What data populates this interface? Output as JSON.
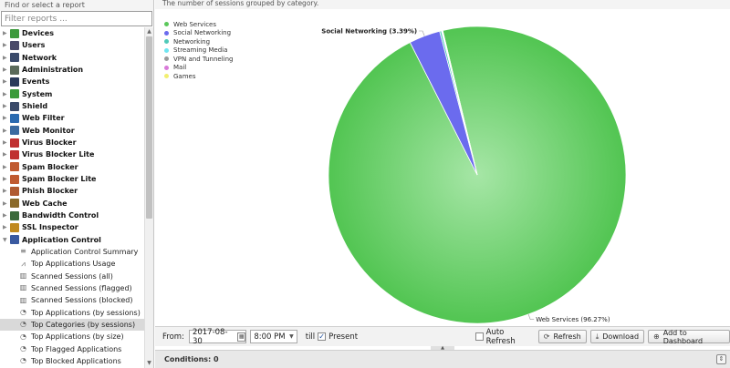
{
  "sidebar": {
    "title": "Find or select a report",
    "filter_placeholder": "Filter reports ...",
    "categories": [
      {
        "label": "Devices",
        "icon": "devices-icon",
        "color": "#3d9a3d"
      },
      {
        "label": "Users",
        "icon": "users-icon",
        "color": "#4a4a6a"
      },
      {
        "label": "Network",
        "icon": "network-icon",
        "color": "#3a4a6a"
      },
      {
        "label": "Administration",
        "icon": "administration-icon",
        "color": "#5a6a5a"
      },
      {
        "label": "Events",
        "icon": "events-icon",
        "color": "#2a3a5a"
      },
      {
        "label": "System",
        "icon": "system-icon",
        "color": "#3a9a3a"
      },
      {
        "label": "Shield",
        "icon": "shield-icon",
        "color": "#3a4a6a"
      },
      {
        "label": "Web Filter",
        "icon": "web-filter-icon",
        "color": "#2a6ab0"
      },
      {
        "label": "Web Monitor",
        "icon": "web-monitor-icon",
        "color": "#3a6aa0"
      },
      {
        "label": "Virus Blocker",
        "icon": "virus-blocker-icon",
        "color": "#c03030"
      },
      {
        "label": "Virus Blocker Lite",
        "icon": "virus-blocker-lite-icon",
        "color": "#c03030"
      },
      {
        "label": "Spam Blocker",
        "icon": "spam-blocker-icon",
        "color": "#c05a30"
      },
      {
        "label": "Spam Blocker Lite",
        "icon": "spam-blocker-lite-icon",
        "color": "#c05a30"
      },
      {
        "label": "Phish Blocker",
        "icon": "phish-blocker-icon",
        "color": "#b05a30"
      },
      {
        "label": "Web Cache",
        "icon": "web-cache-icon",
        "color": "#8a6a2a"
      },
      {
        "label": "Bandwidth Control",
        "icon": "bandwidth-control-icon",
        "color": "#3a6a3a"
      },
      {
        "label": "SSL Inspector",
        "icon": "ssl-inspector-icon",
        "color": "#c08a20"
      },
      {
        "label": "Application Control",
        "icon": "application-control-icon",
        "color": "#3a5aa0"
      }
    ],
    "children": [
      {
        "label": "Application Control Summary",
        "icon": "text-report-icon"
      },
      {
        "label": "Top Applications Usage",
        "icon": "line-chart-icon"
      },
      {
        "label": "Scanned Sessions (all)",
        "icon": "bar-chart-icon"
      },
      {
        "label": "Scanned Sessions (flagged)",
        "icon": "bar-chart-icon"
      },
      {
        "label": "Scanned Sessions (blocked)",
        "icon": "bar-chart-icon"
      },
      {
        "label": "Top Applications (by sessions)",
        "icon": "pie-chart-icon"
      },
      {
        "label": "Top Categories (by sessions)",
        "icon": "pie-chart-icon",
        "selected": true
      },
      {
        "label": "Top Applications (by size)",
        "icon": "pie-chart-icon"
      },
      {
        "label": "Top Flagged Applications",
        "icon": "pie-chart-icon"
      },
      {
        "label": "Top Blocked Applications",
        "icon": "pie-chart-icon"
      }
    ]
  },
  "report": {
    "description": "The number of sessions grouped by category."
  },
  "chart_data": {
    "type": "pie",
    "categories": [
      "Web Services",
      "Social Networking",
      "Networking",
      "Streaming Media",
      "VPN and Tunneling",
      "Mail",
      "Games"
    ],
    "values": [
      96.27,
      3.39,
      0.2,
      0.07,
      0.04,
      0.02,
      0.01
    ],
    "colors": [
      "#5bc85b",
      "#6b6bee",
      "#4fc9b8",
      "#6fe6f2",
      "#9a9a9a",
      "#d97ad9",
      "#f2ef70"
    ],
    "labels": [
      {
        "category": "Social Networking",
        "text": "Social Networking (3.39%)"
      },
      {
        "category": "Web Services",
        "text": "Web Services (96.27%)"
      }
    ],
    "legend_position": "top-left"
  },
  "toolbar": {
    "from_label": "From:",
    "date_value": "2017-08-30",
    "time_value": "8:00 PM",
    "till_label": "till",
    "present_label": "Present",
    "present_checked": true,
    "auto_refresh_label": "Auto Refresh",
    "auto_refresh_checked": false,
    "refresh_label": "Refresh",
    "download_label": "Download",
    "add_dashboard_label": "Add to Dashboard"
  },
  "conditions": {
    "label": "Conditions: 0"
  }
}
